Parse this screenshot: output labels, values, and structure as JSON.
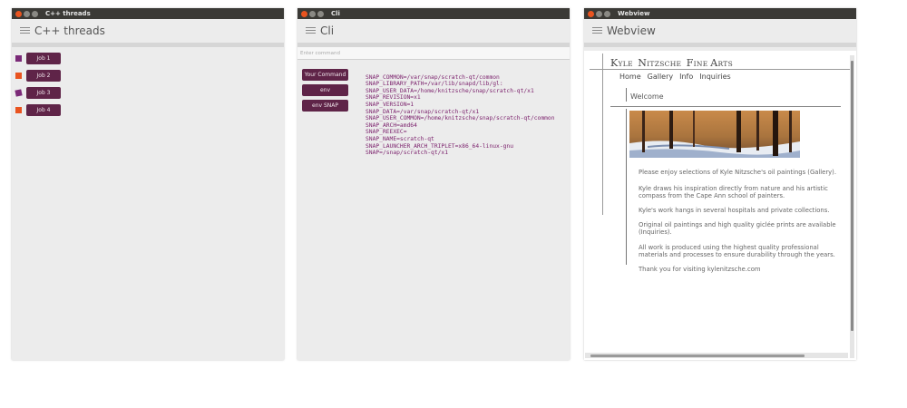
{
  "windows": {
    "threads": {
      "title": "C++ threads",
      "header": "C++ threads",
      "jobs": [
        {
          "label": "Job 1",
          "color": "#7b2a78"
        },
        {
          "label": "Job 2",
          "color": "#e95420"
        },
        {
          "label": "Job 3",
          "color": "#7b2a78"
        },
        {
          "label": "Job 4",
          "color": "#e95420"
        }
      ]
    },
    "cli": {
      "title": "Cli",
      "header": "Cli",
      "input_placeholder": "Enter command",
      "buttons": [
        "Your Command",
        "env",
        "env SNAP"
      ],
      "output": [
        "SNAP_COMMON=/var/snap/scratch-qt/common",
        "SNAP_LIBRARY_PATH=/var/lib/snapd/lib/gl:",
        "SNAP_USER_DATA=/home/knitzsche/snap/scratch-qt/x1",
        "SNAP_REVISION=x1",
        "SNAP_VERSION=1",
        "SNAP_DATA=/var/snap/scratch-qt/x1",
        "SNAP_USER_COMMON=/home/knitzsche/snap/scratch-qt/common",
        "SNAP_ARCH=amd64",
        "SNAP_REEXEC=",
        "SNAP_NAME=scratch-qt",
        "SNAP_LAUNCHER_ARCH_TRIPLET=x86_64-linux-gnu",
        "SNAP=/snap/scratch-qt/x1"
      ]
    },
    "webview": {
      "title": "Webview",
      "header": "Webview",
      "site": {
        "logo_words": [
          {
            "initial": "K",
            "rest": "YLE"
          },
          {
            "initial": "N",
            "rest": "ITZSCHE"
          },
          {
            "initial": "F",
            "rest": "INE"
          },
          {
            "initial": "A",
            "rest": "RTS"
          }
        ],
        "nav": [
          "Home",
          "Gallery",
          "Info",
          "Inquiries"
        ],
        "welcome": "Welcome",
        "paragraphs": [
          "Please enjoy selections of Kyle Nitzsche's oil paintings (Gallery).",
          "Kyle draws his inspiration directly from nature and his artistic compass from the Cape Ann school of painters.",
          "Kyle's work hangs in several hospitals and private collections.",
          "Original oil paintings and high quality giclée prints are available (Inquiries).",
          "All work is produced using the highest quality professional materials and processes to ensure durability through the years.",
          "Thank you for visiting kylenitzsche.com"
        ]
      }
    }
  },
  "colors": {
    "accent": "#5f2448",
    "close": "#e95420",
    "titlebar": "#3b3a36",
    "output_text": "#7a1f6b"
  }
}
